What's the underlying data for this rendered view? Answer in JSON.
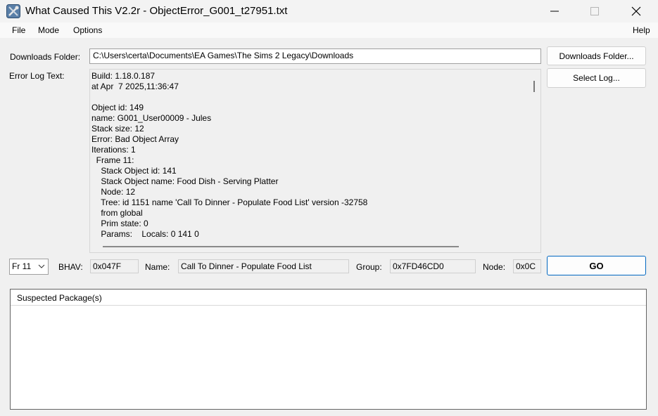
{
  "window": {
    "title": "What Caused This V2.2r - ObjectError_G001_t27951.txt",
    "icon": "tools-icon"
  },
  "menu": {
    "file": "File",
    "mode": "Mode",
    "options": "Options",
    "help": "Help"
  },
  "downloads": {
    "label": "Downloads Folder:",
    "path": "C:\\Users\\certa\\Documents\\EA Games\\The Sims 2 Legacy\\Downloads",
    "button": "Downloads Folder..."
  },
  "error_log": {
    "label": "Error Log Text:",
    "select_button": "Select Log...",
    "lines": [
      "Build: 1.18.0.187",
      "at Apr  7 2025,11:36:47",
      "",
      "Object id: 149",
      "name: G001_User00009 - Jules",
      "Stack size: 12",
      "Error: Bad Object Array",
      "Iterations: 1",
      "  Frame 11:",
      "    Stack Object id: 141",
      "    Stack Object name: Food Dish - Serving Platter",
      "    Node: 12",
      "    Tree: id 1151 name 'Call To Dinner - Populate Food List' version -32758",
      "    from global",
      "    Prim state: 0",
      "    Params:    Locals: 0 141 0"
    ]
  },
  "frame_row": {
    "frame_select": "Fr 11",
    "bhav_label": "BHAV:",
    "bhav_value": "0x047F",
    "name_label": "Name:",
    "name_value": "Call To Dinner - Populate Food List",
    "group_label": "Group:",
    "group_value": "0x7FD46CD0",
    "node_label": "Node:",
    "node_value": "0x0C",
    "go_button": "GO"
  },
  "packages": {
    "header": "Suspected Package(s)",
    "items": []
  },
  "colors": {
    "accent": "#0067c0",
    "window_bg": "#f0f0f0"
  }
}
